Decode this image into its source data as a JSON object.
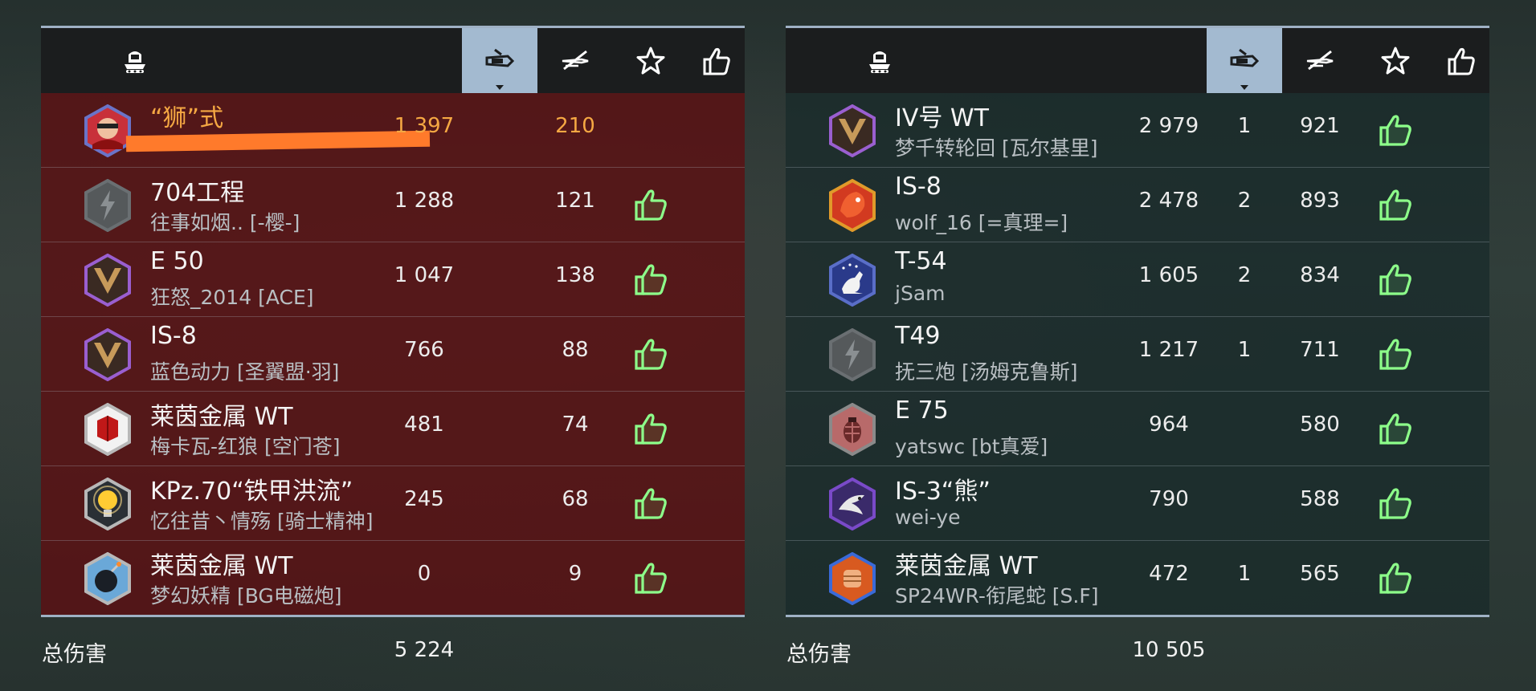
{
  "teams": [
    {
      "side": "left",
      "sort_column": "damage",
      "total_label": "总伤害",
      "total_damage": "5 224",
      "rows": [
        {
          "tank": "“狮”式",
          "player": "",
          "damage": "1 397",
          "kills": "",
          "xp": "210",
          "liked": false,
          "me": true,
          "badge": "avatar-red"
        },
        {
          "tank": "704工程",
          "player": "往事如烟.. [-樱-]",
          "damage": "1 288",
          "kills": "",
          "xp": "121",
          "liked": true,
          "me": false,
          "badge": "gray"
        },
        {
          "tank": "E 50",
          "player": "狂怒_2014 [ACE]",
          "damage": "1 047",
          "kills": "",
          "xp": "138",
          "liked": true,
          "me": false,
          "badge": "purple-v"
        },
        {
          "tank": "IS-8",
          "player": "蓝色动力 [圣翼盟·羽]",
          "damage": "766",
          "kills": "",
          "xp": "88",
          "liked": true,
          "me": false,
          "badge": "purple-v"
        },
        {
          "tank": "莱茵金属 WT",
          "player": "梅卡瓦-红狼 [空门苍]",
          "damage": "481",
          "kills": "",
          "xp": "74",
          "liked": true,
          "me": false,
          "badge": "red-cube"
        },
        {
          "tank": "KPz.70“铁甲洪流”",
          "player": "忆往昔丶情殇 [骑士精神]",
          "damage": "245",
          "kills": "",
          "xp": "68",
          "liked": true,
          "me": false,
          "badge": "bulb"
        },
        {
          "tank": "莱茵金属 WT",
          "player": "梦幻妖精 [BG电磁炮]",
          "damage": "0",
          "kills": "",
          "xp": "9",
          "liked": true,
          "me": false,
          "badge": "bomb"
        }
      ]
    },
    {
      "side": "right",
      "sort_column": "damage",
      "total_label": "总伤害",
      "total_damage": "10 505",
      "rows": [
        {
          "tank": "IV号 WT",
          "player": "梦千转轮回 [瓦尔基里]",
          "damage": "2 979",
          "kills": "1",
          "xp": "921",
          "liked": true,
          "me": false,
          "badge": "purple-v"
        },
        {
          "tank": "IS-8",
          "player": "wolf_16 [=真理=]",
          "damage": "2 478",
          "kills": "2",
          "xp": "893",
          "liked": true,
          "me": false,
          "badge": "red-dragon"
        },
        {
          "tank": "T-54",
          "player": "jSam",
          "damage": "1 605",
          "kills": "2",
          "xp": "834",
          "liked": true,
          "me": false,
          "badge": "kangaroo"
        },
        {
          "tank": "T49",
          "player": "抚三炮 [汤姆克鲁斯]",
          "damage": "1 217",
          "kills": "1",
          "xp": "711",
          "liked": true,
          "me": false,
          "badge": "gray"
        },
        {
          "tank": "E 75",
          "player": "yatswc [bt真爱]",
          "damage": "964",
          "kills": "",
          "xp": "580",
          "liked": true,
          "me": false,
          "badge": "grenade"
        },
        {
          "tank": "IS-3“熊”",
          "player": "wei-ye",
          "damage": "790",
          "kills": "",
          "xp": "588",
          "liked": true,
          "me": false,
          "badge": "eagle"
        },
        {
          "tank": "莱茵金属 WT",
          "player": "SP24WR-衔尾蛇 [S.F]",
          "damage": "472",
          "kills": "1",
          "xp": "565",
          "liked": true,
          "me": false,
          "badge": "fist"
        }
      ]
    }
  ],
  "header_icons": [
    "tank-icon",
    "damage-icon",
    "kills-icon",
    "xp-star-icon",
    "thumbs-up-icon"
  ],
  "colors": {
    "accent_sort": "#a3bad0",
    "me_text": "#f5a843",
    "like_green": "#8dff8a",
    "left_team_bg": "#5c1012",
    "right_team_bg": "#182a2a"
  }
}
